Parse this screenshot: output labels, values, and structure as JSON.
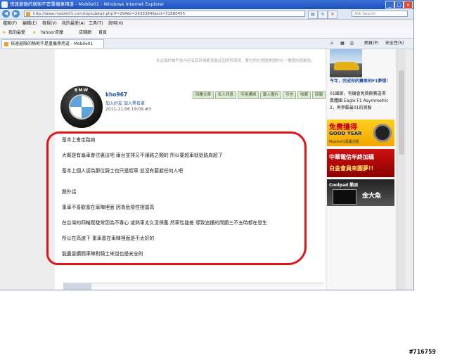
{
  "window": {
    "title": "快速避險的騎術不是重機專用道 - Mobile01 - Windows Internet Explorer",
    "controls": [
      "_",
      "□",
      "×"
    ]
  },
  "address_bar": {
    "url": "http://www.mobile01.com/topicdetail.php?f=294&t=2433384&last=31880455",
    "search_placeholder": "Ask Search"
  },
  "menu": [
    "檔案(F)",
    "編輯(E)",
    "檢視(V)",
    "我的最愛(A)",
    "工具(T)",
    "說明(H)"
  ],
  "favorites_bar": {
    "label": "我的最愛",
    "items": [
      "Yahoo!奇摩",
      "店鋪網",
      "首頁"
    ]
  },
  "tab": {
    "label": "快速避險的騎術不是重機專用道 - Mobile01"
  },
  "toolbar_tools": [
    "網頁(P)",
    "安全性(S)"
  ],
  "page": {
    "top_note": "在這個討論門會內容有其時規範資家此因閃閃現現，要也們在國國美國的在一種國的感謝感。",
    "post": {
      "avatar_brand": "BMW",
      "username": "kho967",
      "user_links": "加入好友 加入黑名單",
      "timestamp": "2011-11-06 19:09  #3",
      "actions": [
        "回覆文章",
        "私人訊息",
        "引用通緝",
        "載入圖片",
        "引言",
        "收藏",
        "回報"
      ],
      "lines": [
        "基本上會走路肩",
        "大概是有龜車會往裏這吧 兩台並排又不讓路之類的 所以要超車就從路肩超了",
        "基本上個人認為那位騎士也只是超車 並沒有要避任何人吧",
        "",
        "題外話",
        "重車不喜歡塞在車陣裡面 因為危險性相當高",
        "在台灣的四輪駕駛常因為不專心 或熱車太久沒保養 然車性能差 導致追撞的問題三不五時都在發生",
        "所以在高速下 重車塞在車陣裡面是不太好的",
        "能盡量鑽開車陣對騎士來說也是安全的"
      ]
    }
  },
  "sidebar": {
    "headline": "今年，完成你的賽車的F1夢想！",
    "blurb": [
      "01國家，有機會免費衝賽道得",
      "異體國 Eagle F1 Asymmetric",
      "2，再參觀最01的測驗"
    ],
    "ads": [
      {
        "title": "免費獲得",
        "subtitle": "GOOD YEAR",
        "extra": "Mobile01專屬活動"
      },
      {
        "title": "中華電信年終加碼",
        "subtitle": "白金會員來圓夢!!"
      },
      {
        "title": "Coolpad 酷派",
        "subtitle": "金大魚"
      }
    ]
  },
  "watermark": "#716759",
  "colors": {
    "title_bar": "#1f4fb8",
    "annotation_red": "#e0141b",
    "link_blue": "#1f4e9c"
  }
}
